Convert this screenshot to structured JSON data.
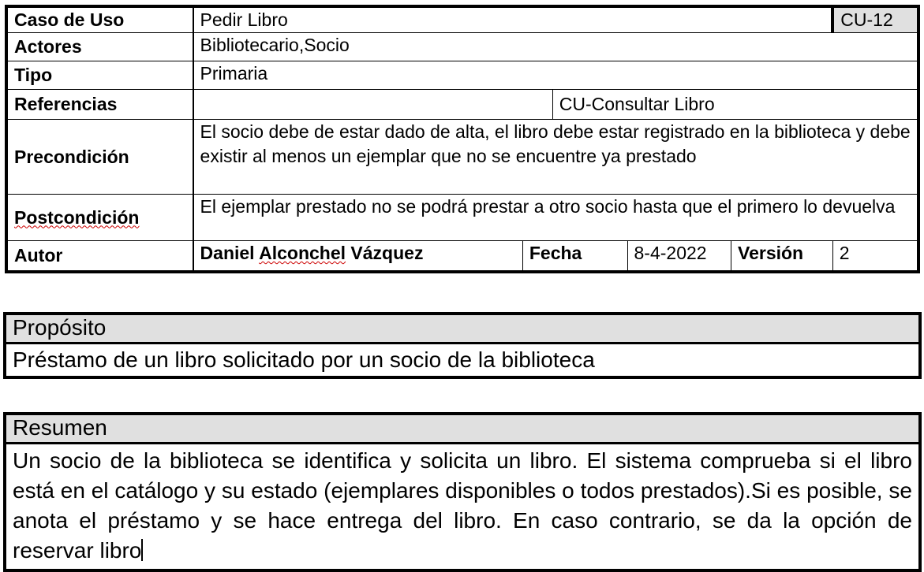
{
  "use_case": {
    "caso_de_uso_label": "Caso de Uso",
    "caso_de_uso_value": "Pedir Libro",
    "code": "CU-12",
    "actores_label": "Actores",
    "actores_value": "Bibliotecario,Socio",
    "tipo_label": "Tipo",
    "tipo_value": "Primaria",
    "referencias_label": "Referencias",
    "referencias_value": "CU-Consultar Libro",
    "precondicion_label": "Precondición",
    "precondicion_value": "El socio debe de estar dado de alta, el libro debe estar registrado en la biblioteca y debe existir al menos un ejemplar que no se encuentre ya prestado",
    "postcondicion_label": "Postcondición",
    "postcondicion_value": "El ejemplar prestado no se podrá prestar a otro socio hasta que el primero lo devuelva",
    "autor_label": "Autor",
    "autor_name_part1": "Daniel ",
    "autor_name_part2": "Alconchel",
    "autor_name_part3": " Vázquez",
    "fecha_label": "Fecha",
    "fecha_value": "8-4-2022",
    "version_label": "Versión",
    "version_value": "2"
  },
  "proposito": {
    "title": "Propósito",
    "text": "Préstamo de un libro solicitado por un socio de la biblioteca"
  },
  "resumen": {
    "title": "Resumen",
    "text": "Un socio de la biblioteca se identifica y solicita un libro. El sistema comprueba si el libro está en el catálogo y su estado (ejemplares disponibles o todos prestados).Si es posible, se anota el préstamo y se hace entrega del libro. En caso contrario, se da la opción de reservar libro"
  }
}
